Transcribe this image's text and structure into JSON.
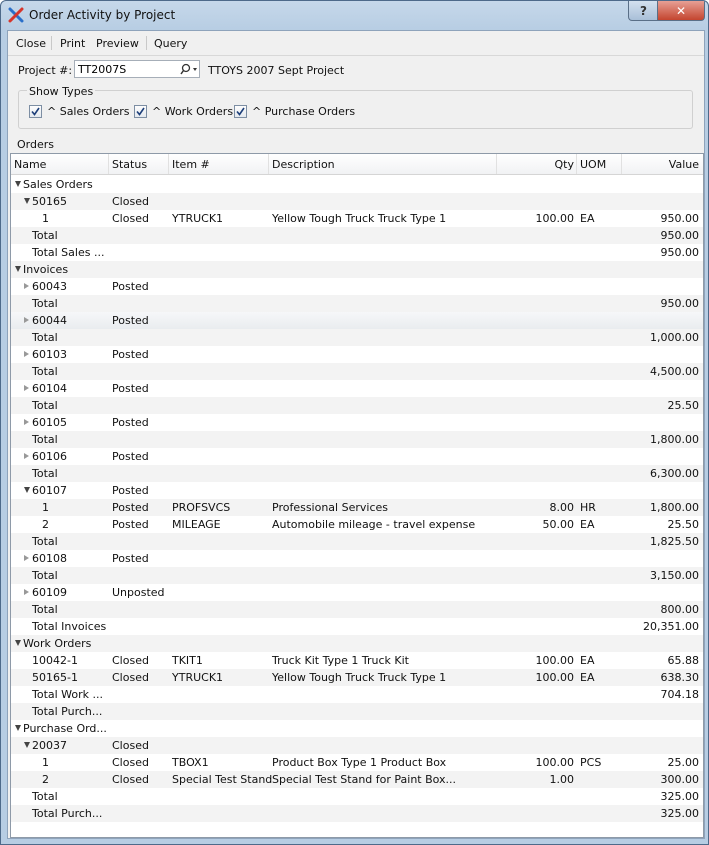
{
  "window": {
    "title": "Order Activity by Project",
    "help_label": "?",
    "close_label": "✕"
  },
  "menu": {
    "items": [
      "Close",
      "Print",
      "Preview",
      "Query"
    ]
  },
  "project": {
    "label": "Project #:",
    "value": "TT2007S",
    "description": "TTOYS 2007 Sept Project"
  },
  "show_types": {
    "title": "Show Types",
    "options": [
      {
        "label": "^ Sales Orders",
        "checked": true
      },
      {
        "label": "^ Work Orders",
        "checked": true
      },
      {
        "label": "^ Purchase Orders",
        "checked": true
      }
    ]
  },
  "orders": {
    "label": "Orders",
    "columns": [
      "Name",
      "Status",
      "Item #",
      "Description",
      "Qty",
      "UOM",
      "Value"
    ],
    "rows": [
      {
        "level": 0,
        "toggle": "expanded",
        "name": "Sales Orders",
        "status": "",
        "item": "",
        "description": "",
        "qty": "",
        "uom": "",
        "value": ""
      },
      {
        "level": 1,
        "toggle": "expanded",
        "name": "50165",
        "status": "Closed",
        "item": "",
        "description": "",
        "qty": "",
        "uom": "",
        "value": ""
      },
      {
        "level": 2,
        "toggle": "",
        "name": "1",
        "status": "Closed",
        "item": "YTRUCK1",
        "description": "Yellow Tough Truck Truck Type 1",
        "qty": "100.00",
        "uom": "EA",
        "value": "950.00"
      },
      {
        "level": 1,
        "toggle": "",
        "name": "Total",
        "status": "",
        "item": "",
        "description": "",
        "qty": "",
        "uom": "",
        "value": "950.00"
      },
      {
        "level": 1,
        "toggle": "",
        "name": "Total Sales ...",
        "status": "",
        "item": "",
        "description": "",
        "qty": "",
        "uom": "",
        "value": "950.00"
      },
      {
        "level": 0,
        "toggle": "expanded",
        "name": "Invoices",
        "status": "",
        "item": "",
        "description": "",
        "qty": "",
        "uom": "",
        "value": ""
      },
      {
        "level": 1,
        "toggle": "collapsed",
        "name": "60043",
        "status": "Posted",
        "item": "",
        "description": "",
        "qty": "",
        "uom": "",
        "value": ""
      },
      {
        "level": 1,
        "toggle": "",
        "name": "Total",
        "status": "",
        "item": "",
        "description": "",
        "qty": "",
        "uom": "",
        "value": "950.00"
      },
      {
        "level": 1,
        "toggle": "collapsed",
        "name": "60044",
        "status": "Posted",
        "item": "",
        "description": "",
        "qty": "",
        "uom": "",
        "value": "",
        "selected": true
      },
      {
        "level": 1,
        "toggle": "",
        "name": "Total",
        "status": "",
        "item": "",
        "description": "",
        "qty": "",
        "uom": "",
        "value": "1,000.00"
      },
      {
        "level": 1,
        "toggle": "collapsed",
        "name": "60103",
        "status": "Posted",
        "item": "",
        "description": "",
        "qty": "",
        "uom": "",
        "value": ""
      },
      {
        "level": 1,
        "toggle": "",
        "name": "Total",
        "status": "",
        "item": "",
        "description": "",
        "qty": "",
        "uom": "",
        "value": "4,500.00"
      },
      {
        "level": 1,
        "toggle": "collapsed",
        "name": "60104",
        "status": "Posted",
        "item": "",
        "description": "",
        "qty": "",
        "uom": "",
        "value": ""
      },
      {
        "level": 1,
        "toggle": "",
        "name": "Total",
        "status": "",
        "item": "",
        "description": "",
        "qty": "",
        "uom": "",
        "value": "25.50"
      },
      {
        "level": 1,
        "toggle": "collapsed",
        "name": "60105",
        "status": "Posted",
        "item": "",
        "description": "",
        "qty": "",
        "uom": "",
        "value": ""
      },
      {
        "level": 1,
        "toggle": "",
        "name": "Total",
        "status": "",
        "item": "",
        "description": "",
        "qty": "",
        "uom": "",
        "value": "1,800.00"
      },
      {
        "level": 1,
        "toggle": "collapsed",
        "name": "60106",
        "status": "Posted",
        "item": "",
        "description": "",
        "qty": "",
        "uom": "",
        "value": ""
      },
      {
        "level": 1,
        "toggle": "",
        "name": "Total",
        "status": "",
        "item": "",
        "description": "",
        "qty": "",
        "uom": "",
        "value": "6,300.00"
      },
      {
        "level": 1,
        "toggle": "expanded",
        "name": "60107",
        "status": "Posted",
        "item": "",
        "description": "",
        "qty": "",
        "uom": "",
        "value": ""
      },
      {
        "level": 2,
        "toggle": "",
        "name": "1",
        "status": "Posted",
        "item": "PROFSVCS",
        "description": "Professional Services",
        "qty": "8.00",
        "uom": "HR",
        "value": "1,800.00"
      },
      {
        "level": 2,
        "toggle": "",
        "name": "2",
        "status": "Posted",
        "item": "MILEAGE",
        "description": "Automobile mileage - travel expense",
        "qty": "50.00",
        "uom": "EA",
        "value": "25.50"
      },
      {
        "level": 1,
        "toggle": "",
        "name": "Total",
        "status": "",
        "item": "",
        "description": "",
        "qty": "",
        "uom": "",
        "value": "1,825.50"
      },
      {
        "level": 1,
        "toggle": "collapsed",
        "name": "60108",
        "status": "Posted",
        "item": "",
        "description": "",
        "qty": "",
        "uom": "",
        "value": ""
      },
      {
        "level": 1,
        "toggle": "",
        "name": "Total",
        "status": "",
        "item": "",
        "description": "",
        "qty": "",
        "uom": "",
        "value": "3,150.00"
      },
      {
        "level": 1,
        "toggle": "collapsed",
        "name": "60109",
        "status": "Unposted",
        "item": "",
        "description": "",
        "qty": "",
        "uom": "",
        "value": ""
      },
      {
        "level": 1,
        "toggle": "",
        "name": "Total",
        "status": "",
        "item": "",
        "description": "",
        "qty": "",
        "uom": "",
        "value": "800.00"
      },
      {
        "level": 1,
        "toggle": "",
        "name": "Total Invoices",
        "status": "",
        "item": "",
        "description": "",
        "qty": "",
        "uom": "",
        "value": "20,351.00"
      },
      {
        "level": 0,
        "toggle": "expanded",
        "name": "Work Orders",
        "status": "",
        "item": "",
        "description": "",
        "qty": "",
        "uom": "",
        "value": ""
      },
      {
        "level": 1,
        "toggle": "",
        "name": "10042-1",
        "status": "Closed",
        "item": "TKIT1",
        "description": "Truck Kit Type 1 Truck Kit",
        "qty": "100.00",
        "uom": "EA",
        "value": "65.88"
      },
      {
        "level": 1,
        "toggle": "",
        "name": "50165-1",
        "status": "Closed",
        "item": "YTRUCK1",
        "description": "Yellow Tough Truck Truck Type 1",
        "qty": "100.00",
        "uom": "EA",
        "value": "638.30"
      },
      {
        "level": 1,
        "toggle": "",
        "name": "Total Work ...",
        "status": "",
        "item": "",
        "description": "",
        "qty": "",
        "uom": "",
        "value": "704.18"
      },
      {
        "level": 1,
        "toggle": "",
        "name": "Total Purch...",
        "status": "",
        "item": "",
        "description": "",
        "qty": "",
        "uom": "",
        "value": ""
      },
      {
        "level": 0,
        "toggle": "expanded",
        "name": "Purchase Ord...",
        "status": "",
        "item": "",
        "description": "",
        "qty": "",
        "uom": "",
        "value": ""
      },
      {
        "level": 1,
        "toggle": "expanded",
        "name": "20037",
        "status": "Closed",
        "item": "",
        "description": "",
        "qty": "",
        "uom": "",
        "value": ""
      },
      {
        "level": 2,
        "toggle": "",
        "name": "1",
        "status": "Closed",
        "item": "TBOX1",
        "description": "Product Box Type 1 Product Box",
        "qty": "100.00",
        "uom": "PCS",
        "value": "25.00"
      },
      {
        "level": 2,
        "toggle": "",
        "name": "2",
        "status": "Closed",
        "item": "Special Test Stand",
        "description": "Special Test Stand for Paint Box...",
        "qty": "1.00",
        "uom": "",
        "value": "300.00"
      },
      {
        "level": 1,
        "toggle": "",
        "name": "Total",
        "status": "",
        "item": "",
        "description": "",
        "qty": "",
        "uom": "",
        "value": "325.00"
      },
      {
        "level": 1,
        "toggle": "",
        "name": "Total Purch...",
        "status": "",
        "item": "",
        "description": "",
        "qty": "",
        "uom": "",
        "value": "325.00"
      }
    ]
  }
}
